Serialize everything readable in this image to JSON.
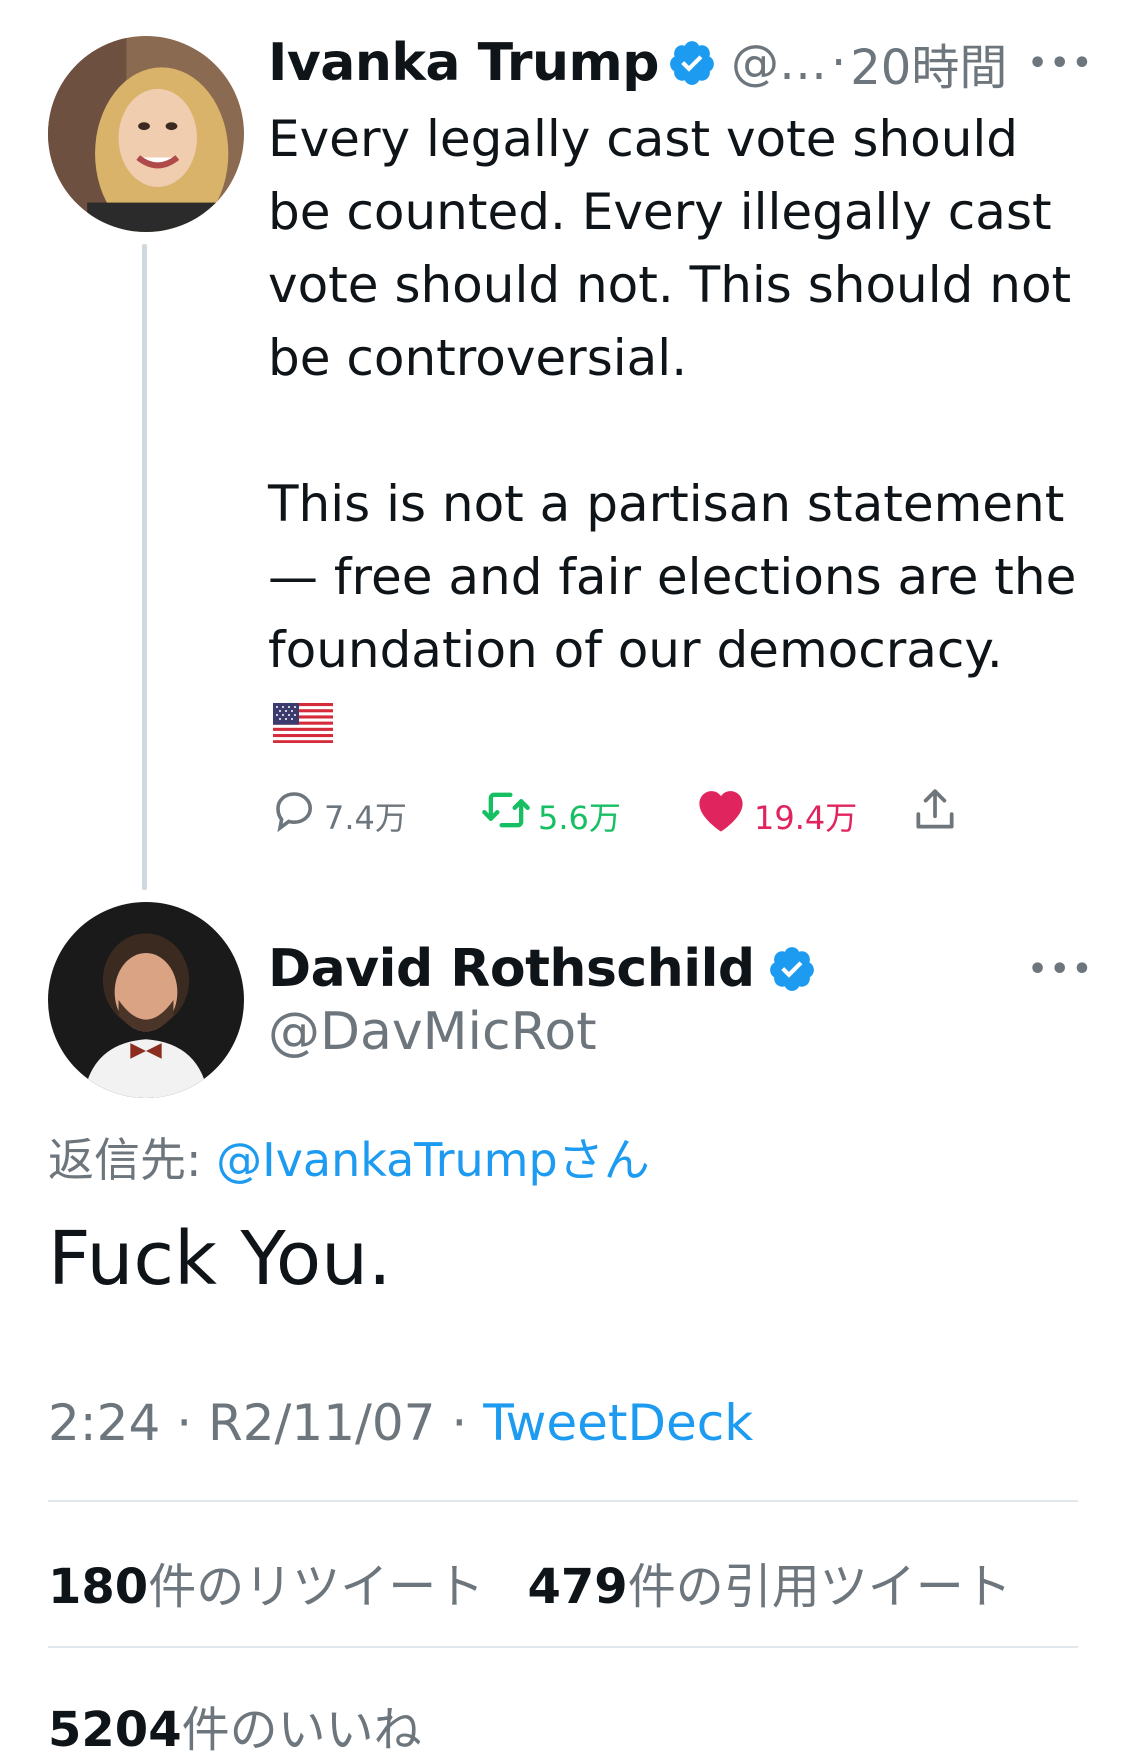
{
  "original_tweet": {
    "author_name": "Ivanka Trump",
    "handle": "@…",
    "separator": "·",
    "time_ago": "20時間",
    "more_label": "•••",
    "text_p1": "Every legally cast vote should\nbe counted. Every illegally cast\nvote should not. This should not\nbe controversial.",
    "text_p2": "This is not a partisan statement\n— free and fair elections are the\nfoundation of our democracy.",
    "flag_icon": "us-flag-icon",
    "stats": {
      "replies": "7.4万",
      "retweets": "5.6万",
      "likes": "19.4万"
    },
    "colors": {
      "retweet": "#17bf63",
      "like": "#e0245e"
    }
  },
  "reply_tweet": {
    "author_name": "David Rothschild",
    "handle": "@DavMicRot",
    "more_label": "•••",
    "reply_to_prefix": "返信先: ",
    "reply_to_mention": "@IvankaTrumpさん",
    "text": "Fuck You.",
    "time": "2:24",
    "date": "R2/11/07",
    "separator": "·",
    "source": "TweetDeck",
    "retweet_count": "180",
    "retweet_label": "件のリツイート",
    "quote_count": "479",
    "quote_label": "件の引用ツイート",
    "like_count": "5204",
    "like_label": "件のいいね"
  },
  "accent_color": "#1d9bf0"
}
